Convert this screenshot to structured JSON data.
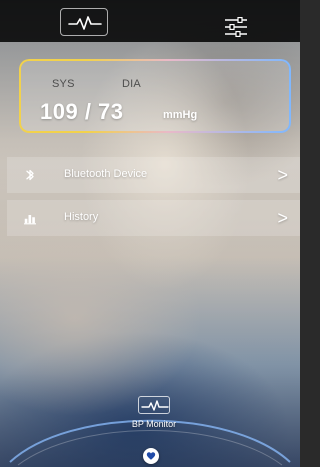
{
  "topbar": {
    "left_icon": "heartbeat-monitor-icon",
    "right_icon": "settings-sliders-icon"
  },
  "bp": {
    "sys_label": "SYS",
    "dia_label": "DIA",
    "value_text": "109 / 73",
    "unit": "mmHg"
  },
  "menu": {
    "items": [
      {
        "icon": "bluetooth-icon",
        "label": "Bluetooth Device",
        "arrow": ">"
      },
      {
        "icon": "history-bars-icon",
        "label": "History",
        "arrow": ">"
      }
    ]
  },
  "bottom_nav": {
    "tab_label": "BP Monitor",
    "tab_icon": "heartbeat-monitor-icon",
    "center_icon": "heart-signal-icon"
  },
  "colors": {
    "topbar_bg": "#000000",
    "card_gradient_left": "#f2d24c",
    "card_gradient_mid": "#e9b9c8",
    "card_gradient_right": "#7fb8ff",
    "text_primary": "#ffffff"
  }
}
